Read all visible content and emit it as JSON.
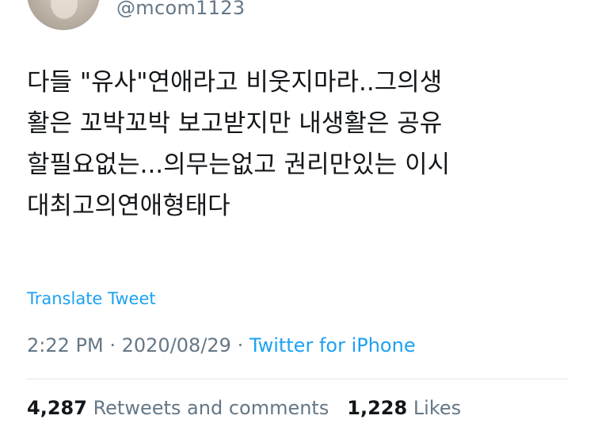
{
  "user": {
    "handle": "@mcom1123"
  },
  "tweet": {
    "text": "다들 \"유사\"연애라고 비웃지마라..그의생\n활은 꼬박꼬박 보고받지만 내생활은 공유\n할필요없는...의무는없고 권리만있는 이시\n대최고의연애형태다",
    "translate_label": "Translate Tweet",
    "time": "2:22 PM",
    "separator": "·",
    "date": "2020/08/29",
    "source": "Twitter for iPhone"
  },
  "stats": {
    "retweets_count": "4,287",
    "retweets_label": "Retweets and comments",
    "likes_count": "1,228",
    "likes_label": "Likes"
  },
  "colors": {
    "link": "#1da1f2",
    "muted": "#657786",
    "text": "#14171a",
    "divider": "#e1e8ed"
  }
}
